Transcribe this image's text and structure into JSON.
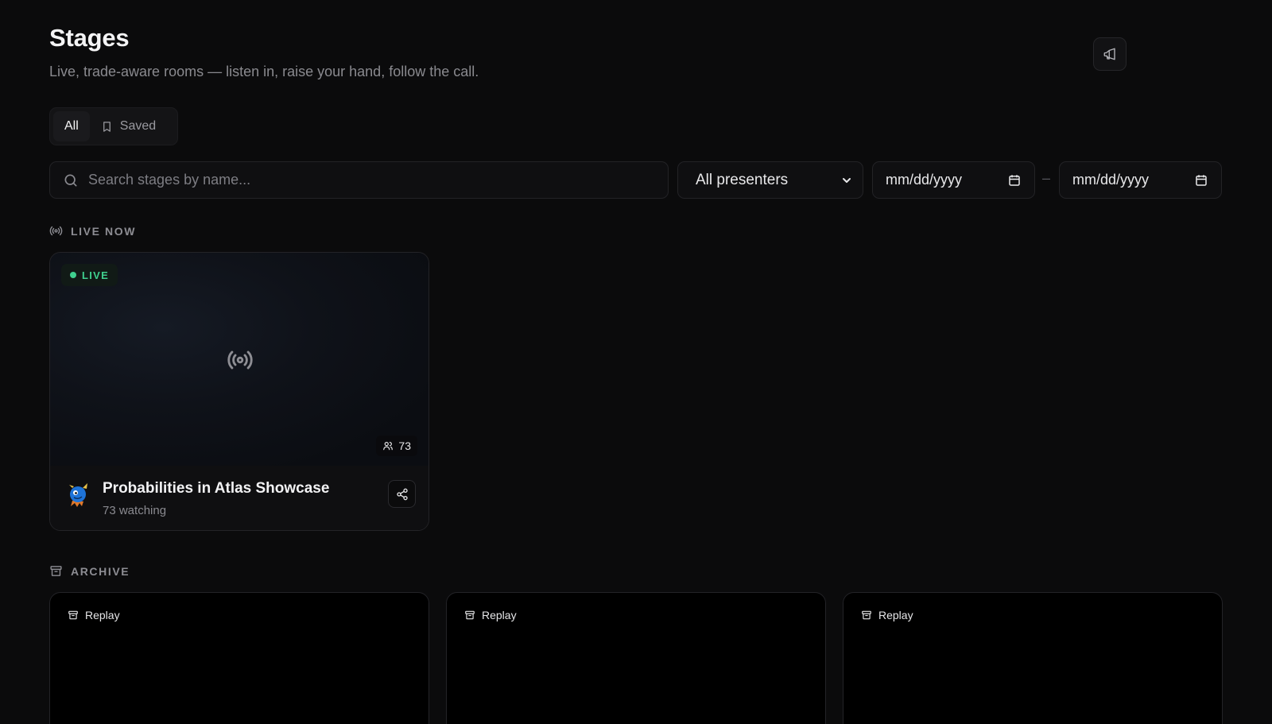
{
  "header": {
    "title": "Stages",
    "subtitle": "Live, trade-aware rooms — listen in, raise your hand, follow the call.",
    "announce_icon": "megaphone-icon"
  },
  "tabs": [
    {
      "label": "All",
      "active": true
    },
    {
      "label": "Saved",
      "active": false,
      "icon": "bookmark-icon"
    }
  ],
  "filters": {
    "search_placeholder": "Search stages by name...",
    "search_value": "",
    "presenter_selected": "All presenters",
    "date_from": "mm/dd/yyyy",
    "date_to": "mm/dd/yyyy",
    "range_separator": "–"
  },
  "sections": {
    "live_label": "LIVE NOW",
    "archive_label": "ARCHIVE"
  },
  "live_stage": {
    "badge": "LIVE",
    "viewer_count": "73",
    "name": "Probabilities in Atlas Showcase",
    "meta": "73 watching"
  },
  "archive": [
    {
      "badge": "Replay"
    },
    {
      "badge": "Replay"
    },
    {
      "badge": "Replay"
    }
  ],
  "colors": {
    "background": "#0b0b0c",
    "live_accent": "#3fcf8e",
    "muted_text": "#8a8a8f"
  }
}
